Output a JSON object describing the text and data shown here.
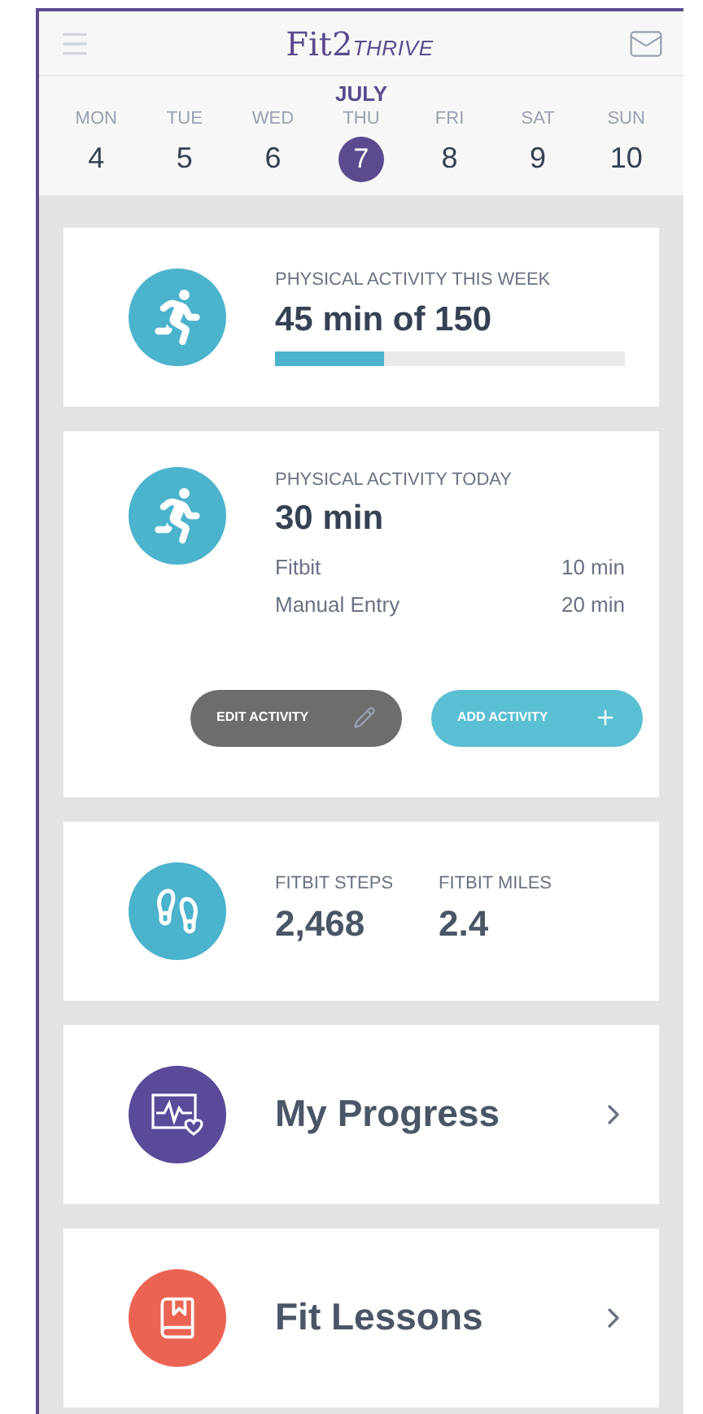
{
  "header": {
    "logo_main": "Fit2",
    "logo_suffix": "THRIVE"
  },
  "calendar": {
    "month": "JULY",
    "days": [
      {
        "weekday": "MON",
        "date": "4",
        "selected": false
      },
      {
        "weekday": "TUE",
        "date": "5",
        "selected": false
      },
      {
        "weekday": "WED",
        "date": "6",
        "selected": false
      },
      {
        "weekday": "THU",
        "date": "7",
        "selected": true
      },
      {
        "weekday": "FRI",
        "date": "8",
        "selected": false
      },
      {
        "weekday": "SAT",
        "date": "9",
        "selected": false
      },
      {
        "weekday": "SUN",
        "date": "10",
        "selected": false
      }
    ]
  },
  "week_card": {
    "label": "PHYSICAL ACTIVITY THIS WEEK",
    "value": "45 min of 150",
    "level": 0.31
  },
  "today_card": {
    "label": "PHYSICAL ACTIVITY TODAY",
    "value": "30 min",
    "rows": [
      {
        "source": "Fitbit",
        "amount": "10 min"
      },
      {
        "source": "Manual Entry",
        "amount": "20 min"
      }
    ],
    "buttons": [
      {
        "kind": "edit",
        "label": "EDIT ACTIVITY"
      },
      {
        "kind": "add",
        "label": "ADD ACTIVITY"
      }
    ]
  },
  "fitbit_card": {
    "stats": [
      {
        "label": "FITBIT STEPS",
        "value": "2,468"
      },
      {
        "label": "FITBIT MILES",
        "value": "2.4"
      }
    ]
  },
  "links": [
    {
      "kind": "progress",
      "label": "My Progress",
      "color": "#5b4a9a"
    },
    {
      "kind": "lessons",
      "label": "Fit Lessons",
      "color": "#eb6352"
    }
  ]
}
